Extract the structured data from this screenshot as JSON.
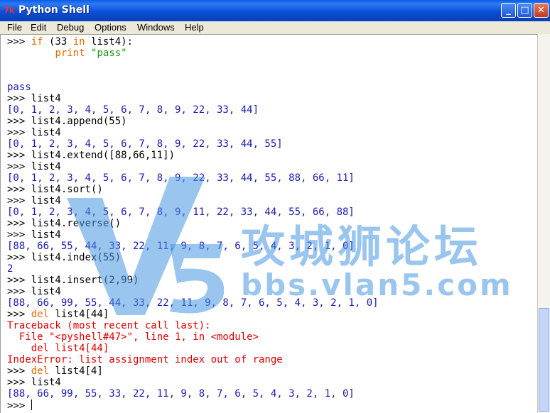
{
  "window": {
    "title": "Python Shell",
    "app_icon_text": "7k",
    "buttons": {
      "minimize": "_",
      "maximize": "□",
      "close": "✕"
    }
  },
  "menu": [
    {
      "label": "File"
    },
    {
      "label": "Edit"
    },
    {
      "label": "Debug"
    },
    {
      "label": "Options"
    },
    {
      "label": "Windows"
    },
    {
      "label": "Help"
    }
  ],
  "shell": {
    "lines": [
      [
        {
          "t": ">>> ",
          "c": "prompt"
        },
        {
          "t": "if",
          "c": "kw"
        },
        {
          "t": " (33 ",
          "c": "plain"
        },
        {
          "t": "in",
          "c": "kw"
        },
        {
          "t": " list4):",
          "c": "plain"
        }
      ],
      [
        {
          "t": "        ",
          "c": "plain"
        },
        {
          "t": "print",
          "c": "kw"
        },
        {
          "t": " ",
          "c": "plain"
        },
        {
          "t": "\"pass\"",
          "c": "str"
        }
      ],
      [],
      [],
      [
        {
          "t": "pass",
          "c": "out"
        }
      ],
      [
        {
          "t": ">>> ",
          "c": "prompt"
        },
        {
          "t": "list4",
          "c": "plain"
        }
      ],
      [
        {
          "t": "[0, 1, 2, 3, 4, 5, 6, 7, 8, 9, 22, 33, 44]",
          "c": "out"
        }
      ],
      [
        {
          "t": ">>> ",
          "c": "prompt"
        },
        {
          "t": "list4.append(55)",
          "c": "plain"
        }
      ],
      [
        {
          "t": ">>> ",
          "c": "prompt"
        },
        {
          "t": "list4",
          "c": "plain"
        }
      ],
      [
        {
          "t": "[0, 1, 2, 3, 4, 5, 6, 7, 8, 9, 22, 33, 44, 55]",
          "c": "out"
        }
      ],
      [
        {
          "t": ">>> ",
          "c": "prompt"
        },
        {
          "t": "list4.extend([88,66,11])",
          "c": "plain"
        }
      ],
      [
        {
          "t": ">>> ",
          "c": "prompt"
        },
        {
          "t": "list4",
          "c": "plain"
        }
      ],
      [
        {
          "t": "[0, 1, 2, 3, 4, 5, 6, 7, 8, 9, 22, 33, 44, 55, 88, 66, 11]",
          "c": "out"
        }
      ],
      [
        {
          "t": ">>> ",
          "c": "prompt"
        },
        {
          "t": "list4.sort()",
          "c": "plain"
        }
      ],
      [
        {
          "t": ">>> ",
          "c": "prompt"
        },
        {
          "t": "list4",
          "c": "plain"
        }
      ],
      [
        {
          "t": "[0, 1, 2, 3, 4, 5, 6, 7, 8, 9, 11, 22, 33, 44, 55, 66, 88]",
          "c": "out"
        }
      ],
      [
        {
          "t": ">>> ",
          "c": "prompt"
        },
        {
          "t": "list4.reverse()",
          "c": "plain"
        }
      ],
      [
        {
          "t": ">>> ",
          "c": "prompt"
        },
        {
          "t": "list4",
          "c": "plain"
        }
      ],
      [
        {
          "t": "[88, 66, 55, 44, 33, 22, 11, 9, 8, 7, 6, 5, 4, 3, 2, 1, 0]",
          "c": "out"
        }
      ],
      [
        {
          "t": ">>> ",
          "c": "prompt"
        },
        {
          "t": "list4.index(55)",
          "c": "plain"
        }
      ],
      [
        {
          "t": "2",
          "c": "out"
        }
      ],
      [
        {
          "t": ">>> ",
          "c": "prompt"
        },
        {
          "t": "list4.insert(2,99)",
          "c": "plain"
        }
      ],
      [
        {
          "t": ">>> ",
          "c": "prompt"
        },
        {
          "t": "list4",
          "c": "plain"
        }
      ],
      [
        {
          "t": "[88, 66, 99, 55, 44, 33, 22, 11, 9, 8, 7, 6, 5, 4, 3, 2, 1, 0]",
          "c": "out"
        }
      ],
      [
        {
          "t": ">>> ",
          "c": "prompt"
        },
        {
          "t": "del",
          "c": "kw"
        },
        {
          "t": " list4[44]",
          "c": "plain"
        }
      ],
      [
        {
          "t": "Traceback (most recent call last):",
          "c": "err"
        }
      ],
      [
        {
          "t": "  File \"<pyshell#47>\", line 1, in <module>",
          "c": "err"
        }
      ],
      [
        {
          "t": "    del list4[44]",
          "c": "err"
        }
      ],
      [
        {
          "t": "IndexError: list assignment index out of range",
          "c": "err"
        }
      ],
      [
        {
          "t": ">>> ",
          "c": "prompt"
        },
        {
          "t": "del",
          "c": "kw"
        },
        {
          "t": " list4[4]",
          "c": "plain"
        }
      ],
      [
        {
          "t": ">>> ",
          "c": "prompt"
        },
        {
          "t": "list4",
          "c": "plain"
        }
      ],
      [
        {
          "t": "[88, 66, 99, 55, 33, 22, 11, 9, 8, 7, 6, 5, 4, 3, 2, 1, 0]",
          "c": "out"
        }
      ],
      [
        {
          "t": ">>> ",
          "c": "prompt"
        }
      ]
    ]
  },
  "watermark": {
    "text": "攻城狮论坛",
    "url": "bbs.vlan5.com"
  },
  "colors": {
    "keyword": "#e56a00",
    "string": "#159b15",
    "output": "#1a1ab4",
    "error": "#e00000",
    "titlebar": "#0a4fd6"
  }
}
